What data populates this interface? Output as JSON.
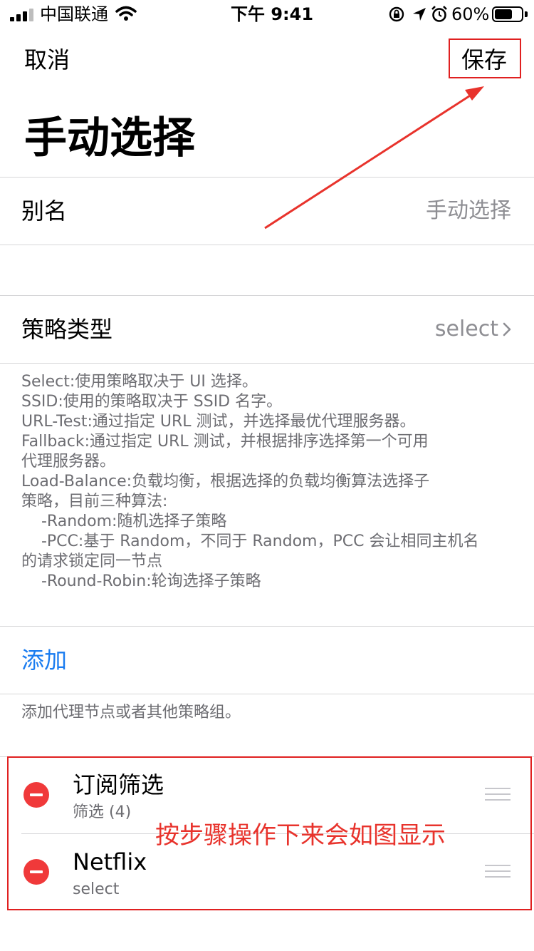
{
  "status_bar": {
    "carrier": "中国联通",
    "time": "下午 9:41",
    "battery": "60%",
    "icons": [
      "signal-icon",
      "wifi-icon",
      "orientation-lock-icon",
      "location-icon",
      "alarm-icon",
      "battery-icon"
    ],
    "battery_level": 0.6
  },
  "nav": {
    "cancel": "取消",
    "save": "保存"
  },
  "page_title": "手动选择",
  "alias": {
    "label": "别名",
    "value": "手动选择"
  },
  "policy_type": {
    "label": "策略类型",
    "value": "select",
    "chevron": "chevron-right-icon"
  },
  "description": [
    "Select:使用策略取决于 UI 选择。",
    "SSID:使用的策略取决于 SSID 名字。",
    "URL-Test:通过指定 URL 测试，并选择最优代理服务器。",
    "Fallback:通过指定 URL 测试，并根据排序选择第一个可用",
    "代理服务器。",
    "Load-Balance:负载均衡，根据选择的负载均衡算法选择子",
    "策略，目前三种算法:",
    "    -Random:随机选择子策略",
    "    -PCC:基于 Random，不同于 Random，PCC 会让相同主机名",
    "的请求锁定同一节点",
    "    -Round-Robin:轮询选择子策略"
  ],
  "add_button": "添加",
  "add_note": "添加代理节点或者其他策略组。",
  "items": [
    {
      "title": "订阅筛选",
      "subtitle": "筛选 (4)"
    },
    {
      "title": "Netflix",
      "subtitle": "select"
    }
  ],
  "annotation": "按步骤操作下来会如图显示",
  "colors": {
    "accent": "#1a7cf0",
    "annotation_red": "#e02020",
    "delete_red": "#f0393a",
    "secondary_text": "#8e8e93"
  }
}
